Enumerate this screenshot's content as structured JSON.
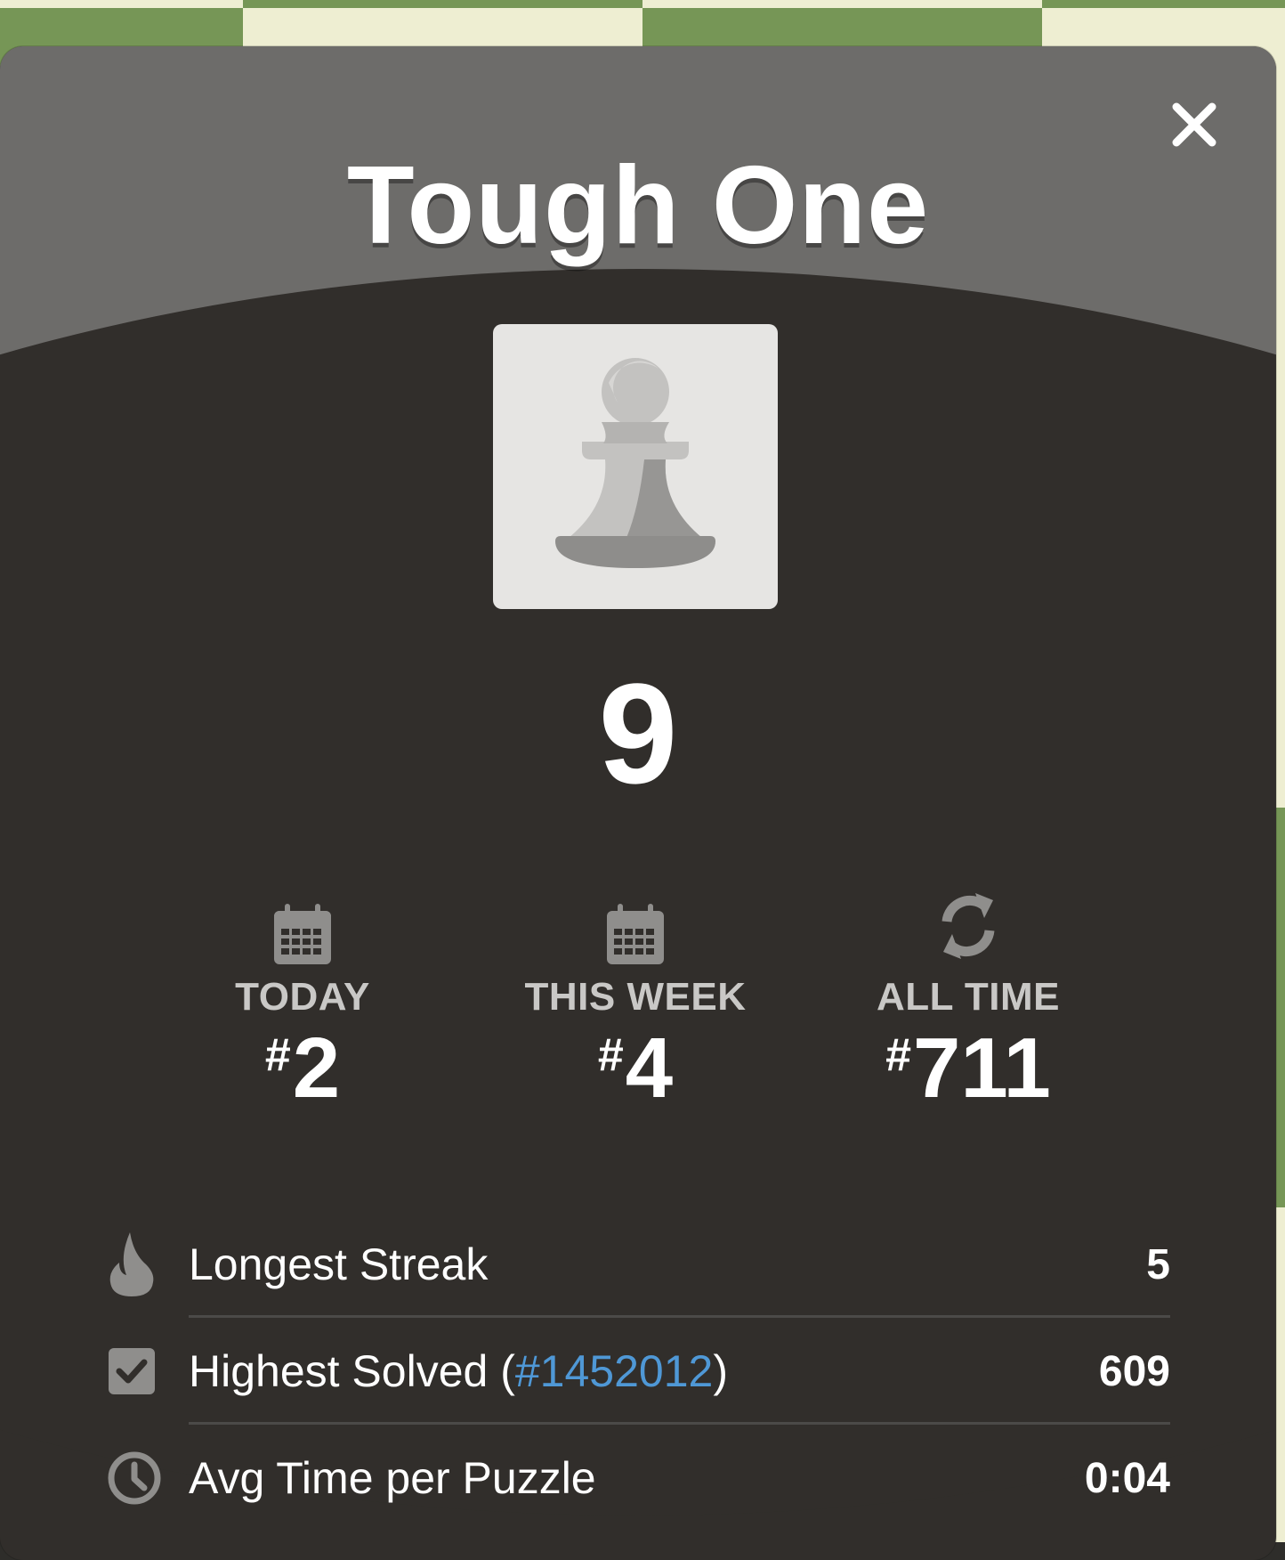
{
  "modal": {
    "title": "Tough One",
    "close_icon": "close-icon",
    "piece_icon": "pawn-icon",
    "score": "9"
  },
  "periods": [
    {
      "icon": "calendar-icon",
      "label": "TODAY",
      "rank": "2"
    },
    {
      "icon": "calendar-icon",
      "label": "THIS WEEK",
      "rank": "4"
    },
    {
      "icon": "refresh-icon",
      "label": "ALL TIME",
      "rank": "711"
    }
  ],
  "hash_symbol": "#",
  "stats": {
    "longest_streak": {
      "icon": "flame-icon",
      "label": "Longest Streak",
      "value": "5"
    },
    "highest_solved": {
      "icon": "checkbox-icon",
      "label_prefix": "Highest Solved (",
      "link": "#1452012",
      "label_suffix": ")",
      "value": "609"
    },
    "avg_time": {
      "icon": "clock-icon",
      "label": "Avg Time per Puzzle",
      "value": "0:04"
    }
  },
  "colors": {
    "accent_link": "#4f98d6",
    "board_light": "#eeeed2",
    "board_dark": "#769656",
    "modal_bg": "#312e2b"
  }
}
